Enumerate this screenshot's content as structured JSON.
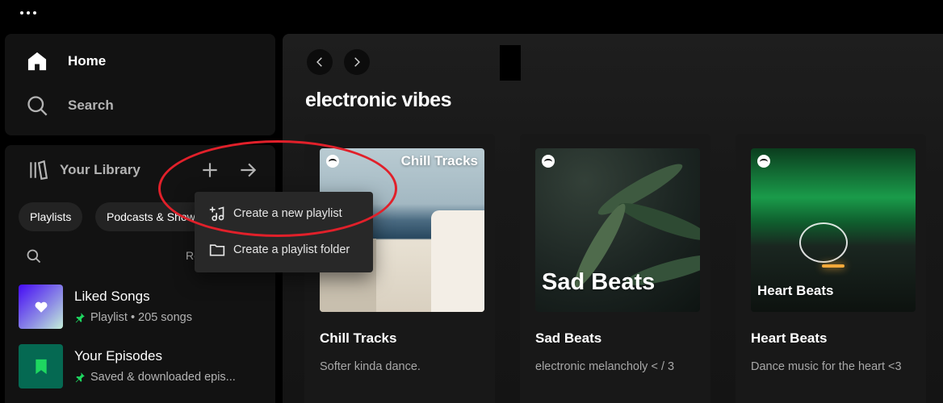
{
  "nav": {
    "home_label": "Home",
    "search_label": "Search"
  },
  "library": {
    "title": "Your Library",
    "filters": [
      "Playlists",
      "Podcasts & Shows"
    ],
    "sort_label": "Recents",
    "items": [
      {
        "title": "Liked Songs",
        "subtitle": "Playlist • 205 songs"
      },
      {
        "title": "Your Episodes",
        "subtitle": "Saved & downloaded epis..."
      }
    ]
  },
  "context_menu": {
    "items": [
      {
        "label": "Create a new playlist",
        "icon": "new-playlist-icon"
      },
      {
        "label": "Create a playlist folder",
        "icon": "folder-icon"
      }
    ]
  },
  "main": {
    "section_title": "electronic vibes",
    "cards": [
      {
        "cover_text": "Chill Tracks",
        "title": "Chill Tracks",
        "description": "Softer kinda dance."
      },
      {
        "cover_text": "Sad Beats",
        "title": "Sad Beats",
        "description": "electronic melancholy < / 3"
      },
      {
        "cover_text": "Heart Beats",
        "title": "Heart Beats",
        "description": "Dance music for the heart <3"
      }
    ]
  },
  "colors": {
    "accent": "#1ed760",
    "panel": "#121212",
    "highlight_oval": "#e1202a"
  }
}
